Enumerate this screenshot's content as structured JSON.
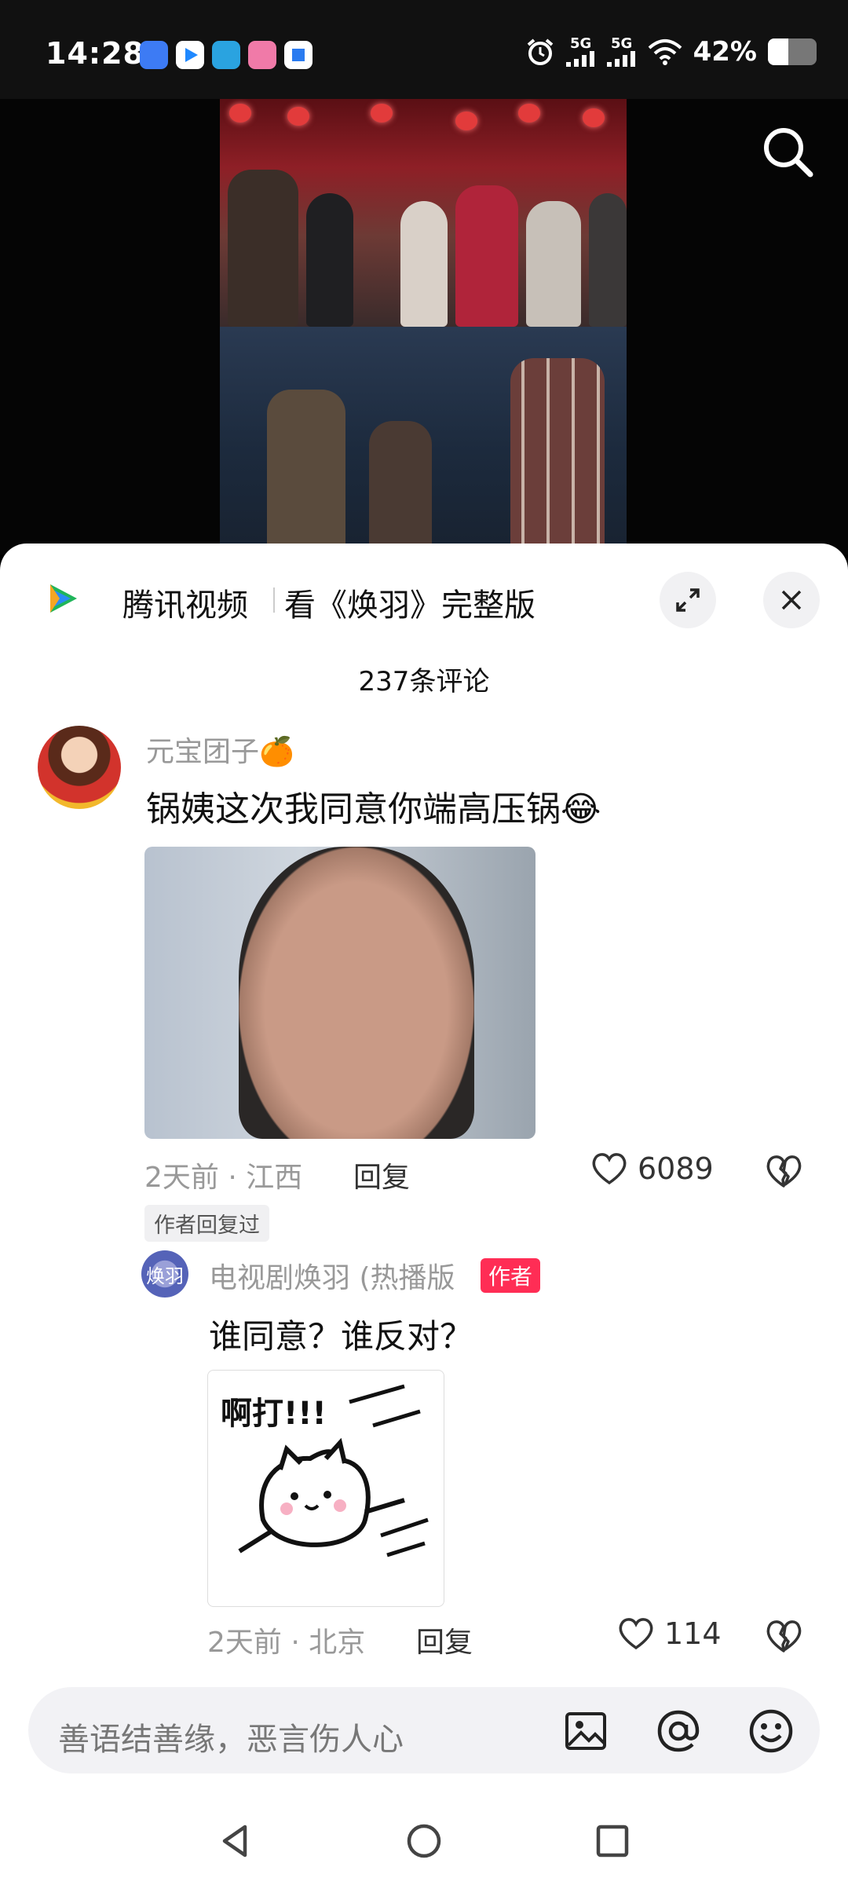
{
  "status_bar": {
    "time": "14:28",
    "signal1": "5G",
    "signal2": "5G",
    "battery_text": "42%",
    "battery_level": 0.42,
    "app_icons": [
      "app-icon-blue",
      "app-icon-play",
      "app-icon-telegram",
      "app-icon-bilibili",
      "app-icon-square"
    ]
  },
  "video": {
    "search_icon": "search-icon"
  },
  "sheet": {
    "brand": "腾讯视频",
    "link_text": "看《焕羽》完整版",
    "comment_count": "237条评论"
  },
  "comments": [
    {
      "username": "元宝团子🍊",
      "text": "锅姨这次我同意你端高压锅😂",
      "time_location": "2天前 · 江西",
      "reply_label": "回复",
      "likes": "6089",
      "author_replied_tag": "作者回复过"
    }
  ],
  "reply": {
    "avatar_text": "焕羽",
    "username": "电视剧焕羽 (热播版",
    "badge": "作者",
    "text": "谁同意？谁反对？",
    "sticker_text": "啊打!!!",
    "time_location": "2天前 · 北京",
    "reply_label": "回复",
    "likes": "114"
  },
  "input": {
    "placeholder": "善语结善缘，恶言伤人心"
  },
  "colors": {
    "accent": "#ff2d55",
    "muted": "#999999"
  }
}
